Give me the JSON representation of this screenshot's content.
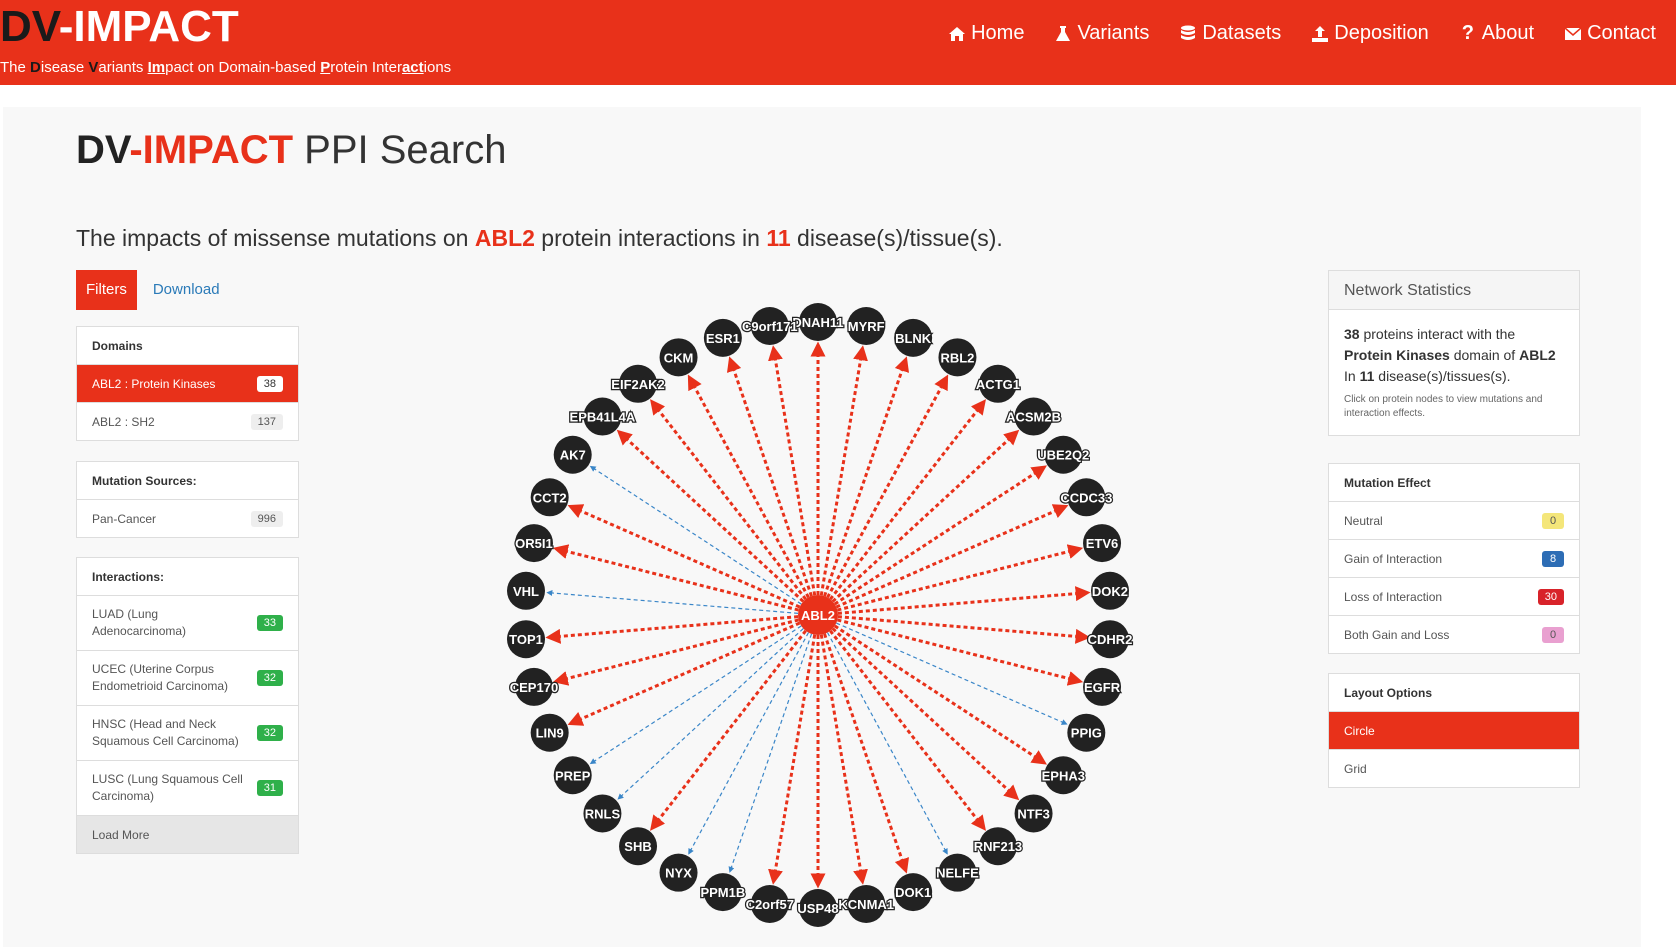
{
  "brand": {
    "dv": "DV",
    "rest": "-IMPACT"
  },
  "tagline": {
    "p1": "The ",
    "d": "D",
    "p2": "isease ",
    "v": "V",
    "p3": "ariants ",
    "im": "Im",
    "p4": "pact on Domain-based ",
    "pr": "P",
    "p5": "rotein Inter",
    "act": "act",
    "p6": "ions"
  },
  "nav": [
    {
      "label": "Home",
      "icon": "home-icon"
    },
    {
      "label": "Variants",
      "icon": "flask-icon"
    },
    {
      "label": "Datasets",
      "icon": "database-icon"
    },
    {
      "label": "Deposition",
      "icon": "upload-icon"
    },
    {
      "label": "About",
      "icon": "question-icon"
    },
    {
      "label": "Contact",
      "icon": "envelope-icon"
    }
  ],
  "page": {
    "title_dv": "DV",
    "title_impact": "-IMPACT",
    "title_rest": " PPI Search",
    "sub_p1": "The impacts of missense mutations on ",
    "sub_protein": "ABL2",
    "sub_p2": " protein interactions in ",
    "sub_count": "11",
    "sub_p3": " disease(s)/tissue(s)."
  },
  "tabs": {
    "filters": "Filters",
    "download": "Download"
  },
  "domains": {
    "heading": "Domains",
    "items": [
      {
        "label": "ABL2 : Protein Kinases",
        "count": "38"
      },
      {
        "label": "ABL2 : SH2",
        "count": "137"
      }
    ]
  },
  "mutation_sources": {
    "heading": "Mutation Sources:",
    "items": [
      {
        "label": "Pan-Cancer",
        "count": "996"
      }
    ]
  },
  "interactions": {
    "heading": "Interactions:",
    "items": [
      {
        "l1": "LUAD (Lung",
        "l2": "Adenocarcinoma)",
        "count": "33"
      },
      {
        "l1": "UCEC (Uterine Corpus",
        "l2": "Endometrioid Carcinoma)",
        "count": "32"
      },
      {
        "l1": "HNSC (Head and Neck",
        "l2": "Squamous Cell Carcinoma)",
        "count": "32"
      },
      {
        "l1": "LUSC (Lung Squamous Cell",
        "l2": "Carcinoma)",
        "count": "31"
      }
    ],
    "load_more": "Load More"
  },
  "stats": {
    "heading": "Network Statistics",
    "count": "38",
    "p1": " proteins interact with the ",
    "domain": "Protein Kinases",
    "p2": " domain of ",
    "protein": "ABL2",
    "p3": " In ",
    "ndis": "11",
    "p4": " disease(s)/tissues(s).",
    "note": "Click on protein nodes to view mutations and interaction effects."
  },
  "mutation_effect": {
    "heading": "Mutation Effect",
    "items": [
      {
        "label": "Neutral",
        "count": "0"
      },
      {
        "label": "Gain of Interaction",
        "count": "8"
      },
      {
        "label": "Loss of Interaction",
        "count": "30"
      },
      {
        "label": "Both Gain and Loss",
        "count": "0"
      }
    ]
  },
  "layout_options": {
    "heading": "Layout Options",
    "items": [
      {
        "label": "Circle"
      },
      {
        "label": "Grid"
      }
    ]
  },
  "colors": {
    "accent": "#e8311a",
    "loss_edge": "#e8311a",
    "gain_edge": "#3a86c8",
    "node": "#222222"
  },
  "network": {
    "center": "ABL2",
    "nodes": [
      {
        "name": "DNAH11",
        "effect": "loss"
      },
      {
        "name": "MYRF",
        "effect": "loss"
      },
      {
        "name": "BLNK",
        "effect": "loss"
      },
      {
        "name": "RBL2",
        "effect": "loss"
      },
      {
        "name": "ACTG1",
        "effect": "loss"
      },
      {
        "name": "ACSM2B",
        "effect": "loss"
      },
      {
        "name": "UBE2Q2",
        "effect": "loss"
      },
      {
        "name": "CCDC33",
        "effect": "loss"
      },
      {
        "name": "ETV6",
        "effect": "loss"
      },
      {
        "name": "DOK2",
        "effect": "loss"
      },
      {
        "name": "CDHR2",
        "effect": "loss"
      },
      {
        "name": "EGFR",
        "effect": "loss"
      },
      {
        "name": "PPIG",
        "effect": "gain"
      },
      {
        "name": "EPHA3",
        "effect": "loss"
      },
      {
        "name": "NTF3",
        "effect": "loss"
      },
      {
        "name": "RNF213",
        "effect": "loss"
      },
      {
        "name": "NELFE",
        "effect": "gain"
      },
      {
        "name": "DOK1",
        "effect": "loss"
      },
      {
        "name": "KCNMA1",
        "effect": "loss"
      },
      {
        "name": "USP48",
        "effect": "loss"
      },
      {
        "name": "C2orf57",
        "effect": "loss"
      },
      {
        "name": "PPM1B",
        "effect": "gain"
      },
      {
        "name": "NYX",
        "effect": "gain"
      },
      {
        "name": "SHB",
        "effect": "loss"
      },
      {
        "name": "RNLS",
        "effect": "gain"
      },
      {
        "name": "PREP",
        "effect": "gain"
      },
      {
        "name": "LIN9",
        "effect": "loss"
      },
      {
        "name": "CEP170",
        "effect": "loss"
      },
      {
        "name": "TOP1",
        "effect": "loss"
      },
      {
        "name": "VHL",
        "effect": "gain"
      },
      {
        "name": "OR5I1",
        "effect": "loss"
      },
      {
        "name": "CCT2",
        "effect": "loss"
      },
      {
        "name": "AK7",
        "effect": "gain"
      },
      {
        "name": "EPB41L4A",
        "effect": "loss"
      },
      {
        "name": "EIF2AK2",
        "effect": "loss"
      },
      {
        "name": "CKM",
        "effect": "loss"
      },
      {
        "name": "ESR1",
        "effect": "loss"
      },
      {
        "name": "C9orf171",
        "effect": "loss"
      }
    ]
  }
}
